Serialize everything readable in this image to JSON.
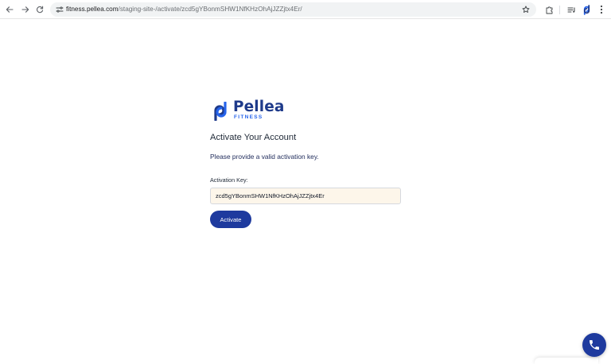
{
  "browser": {
    "url_domain": "fitness.pellea.com",
    "url_path": "/staging-site-/activate/zcd5gYBonmSHW1NfKHzOhAjJZZjtx4Er/",
    "icons": [
      "back-icon",
      "forward-icon",
      "reload-icon",
      "site-settings-icon",
      "star-icon",
      "extensions-icon",
      "media-controls-icon",
      "pellea-extension-icon",
      "menu-icon"
    ]
  },
  "brand": {
    "name": "Pellea",
    "sub": "FITNESS",
    "color": "#1e3a8a",
    "accent": "#2563eb"
  },
  "page": {
    "title": "Activate Your Account",
    "message": "Please provide a valid activation key.",
    "field_label": "Activation Key:",
    "field_value": "zcd5gYBonmSHW1NfKHzOhAjJZZjtx4Er",
    "button_label": "Activate",
    "button_color": "#1e3a9e"
  },
  "widgets": {
    "phone_icon": "phone-icon"
  }
}
